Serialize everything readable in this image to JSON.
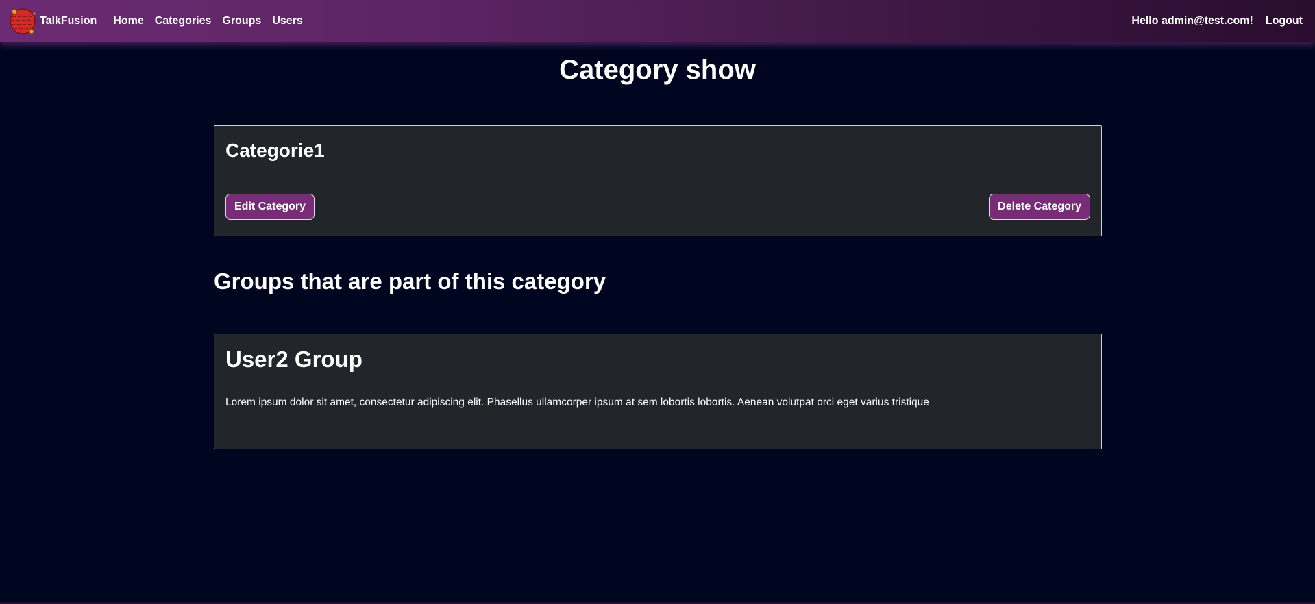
{
  "navbar": {
    "brand": "TalkFusion",
    "links": [
      {
        "label": "Home"
      },
      {
        "label": "Categories"
      },
      {
        "label": "Groups"
      },
      {
        "label": "Users"
      }
    ],
    "greeting": "Hello admin@test.com!",
    "logout": "Logout"
  },
  "page": {
    "title": "Category show"
  },
  "category": {
    "name": "Categorie1",
    "edit_label": "Edit Category",
    "delete_label": "Delete Category"
  },
  "groups_section": {
    "title": "Groups that are part of this category",
    "groups": [
      {
        "name": "User2 Group",
        "description": "Lorem ipsum dolor sit amet, consectetur adipiscing elit. Phasellus ullamcorper ipsum at sem lobortis lobortis. Aenean volutpat orci eget varius tristique"
      }
    ]
  },
  "colors": {
    "background": "#010620",
    "navbar_start": "#6c2b72",
    "navbar_end": "#2a0d2f",
    "card_background": "#222529",
    "button": "#782c77"
  },
  "icons": {
    "brand_logo": "planet-logo-icon"
  }
}
